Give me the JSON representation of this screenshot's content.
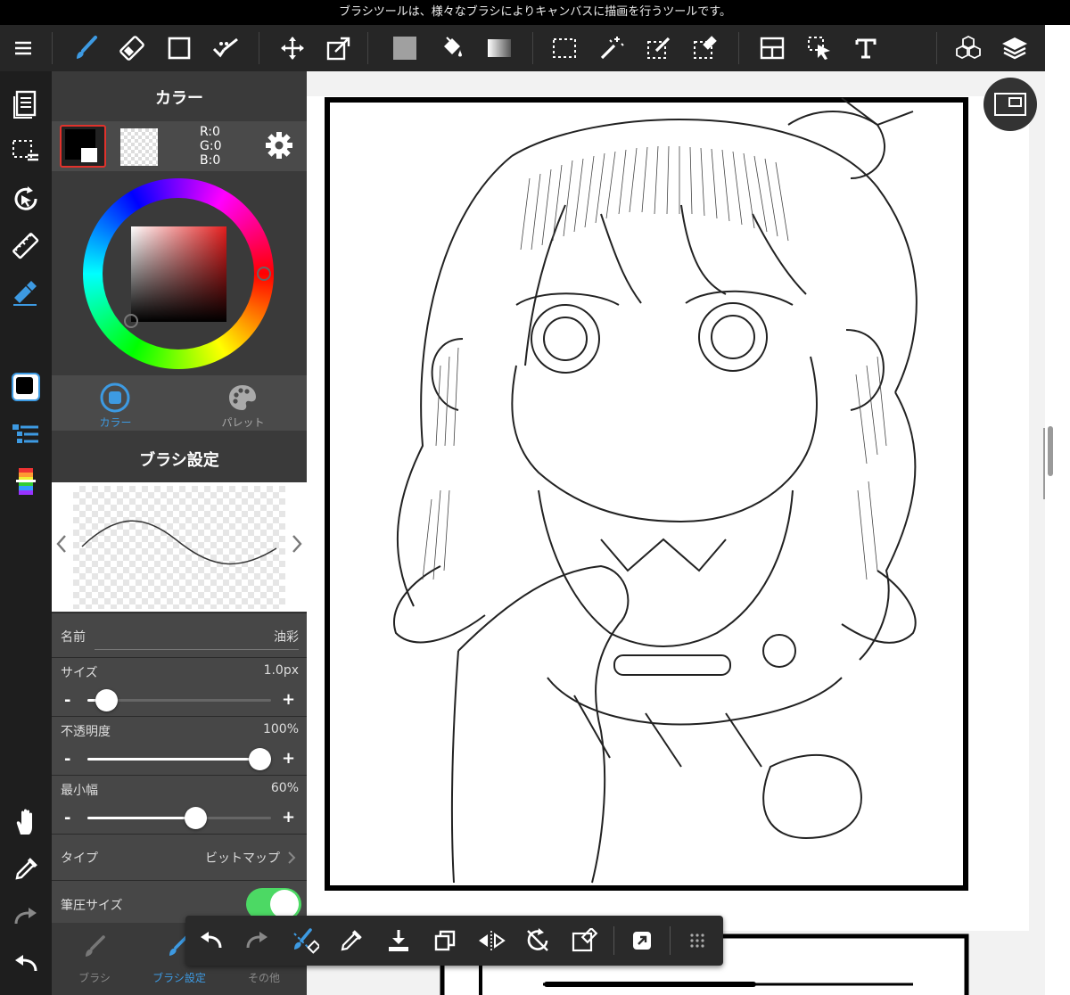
{
  "hint_text": "ブラシツールは、様々なブラシによりキャンバスに描画を行うツールです。",
  "color_panel": {
    "title": "カラー",
    "rgb": {
      "r": "R:0",
      "g": "G:0",
      "b": "B:0"
    },
    "tabs": [
      {
        "label": "カラー",
        "active": true
      },
      {
        "label": "パレット",
        "active": false
      }
    ]
  },
  "brush_panel": {
    "title": "ブラシ設定",
    "name_label": "名前",
    "name_value": "油彩",
    "size": {
      "label": "サイズ",
      "value": "1.0px",
      "fraction": 0.05
    },
    "opacity": {
      "label": "不透明度",
      "value": "100%",
      "fraction": 1.0
    },
    "min_width": {
      "label": "最小幅",
      "value": "60%",
      "fraction": 0.6
    },
    "type": {
      "label": "タイプ",
      "value": "ビットマップ"
    },
    "pressure": {
      "label": "筆圧サイズ",
      "on": true
    },
    "minus": "-",
    "plus": "+"
  },
  "bottom_tabs": [
    {
      "label": "ブラシ",
      "active": false
    },
    {
      "label": "ブラシ設定",
      "active": true
    },
    {
      "label": "その他",
      "active": false
    }
  ],
  "colors": {
    "accent": "#3d9ae2",
    "toggle_on": "#4cd964",
    "selected_border": "#e0322c",
    "toolbar_bg": "#262626",
    "panel_bg": "#3a3a3a"
  },
  "icons": {
    "toolbar": [
      "menu-icon",
      "brush-icon",
      "eraser-icon",
      "rectangle-icon",
      "dot-brush-icon",
      "move-icon",
      "transform-icon",
      "fill-square-icon",
      "bucket-icon",
      "gradient-icon",
      "rect-select-icon",
      "magic-wand-icon",
      "select-pen-icon",
      "select-eraser-icon",
      "panel-layout-icon",
      "arrow-select-icon",
      "text-icon",
      "3d-cube-icon",
      "layers-icon"
    ],
    "floating": [
      "undo-icon",
      "redo-icon",
      "brush-icon",
      "eyedropper-icon",
      "download-icon",
      "copy-icon",
      "flip-icon",
      "rotate-icon",
      "clear-icon",
      "share-icon",
      "grid-icon"
    ]
  }
}
